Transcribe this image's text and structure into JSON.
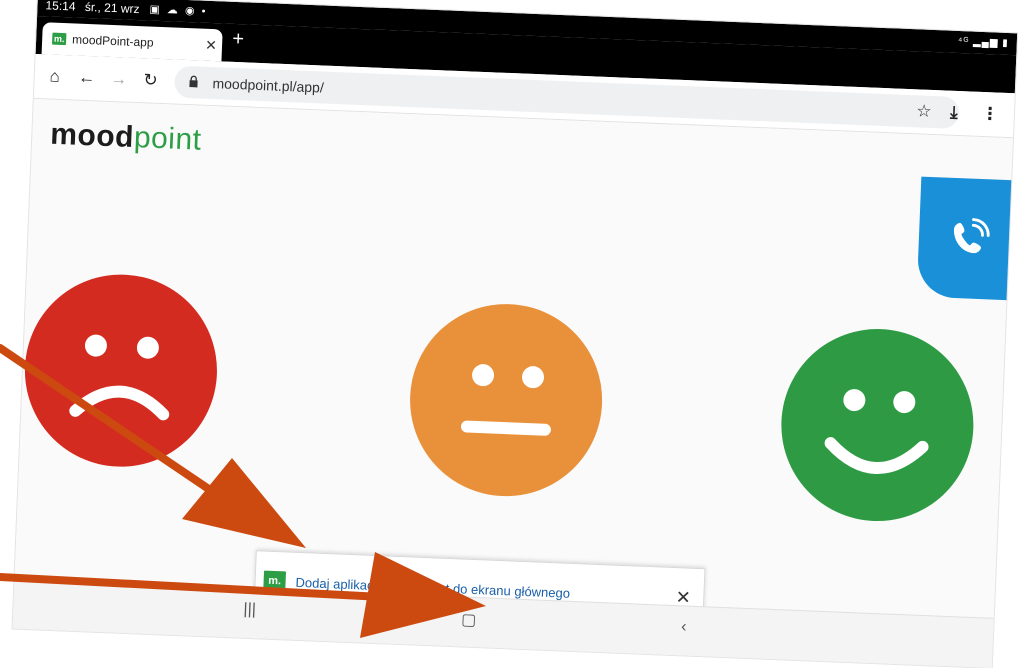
{
  "status_bar": {
    "time": "15:14",
    "date": "śr., 21 wrz",
    "notification_icons": [
      "image-icon",
      "cloud-icon",
      "chrome-icon",
      "dot-icon"
    ],
    "system_icons": [
      "lte-icon",
      "signal-icon",
      "battery-icon"
    ]
  },
  "browser": {
    "tab_title": "moodPoint-app",
    "favicon_text": "m.",
    "url": "moodpoint.pl/app/"
  },
  "page": {
    "logo_mood": "mood",
    "logo_point": "point",
    "faces": [
      "sad",
      "neutral",
      "happy"
    ],
    "colors": {
      "sad": "#d42b20",
      "neutral": "#e8913a",
      "happy": "#2e9b44",
      "call": "#1a90d9",
      "brand": "#2e9e46"
    }
  },
  "install_banner": {
    "text": "Dodaj aplikacje moodPoint do ekranu głównego",
    "close": "✕"
  },
  "annotation_arrows": {
    "color": "#cc4a10",
    "count": 2
  }
}
